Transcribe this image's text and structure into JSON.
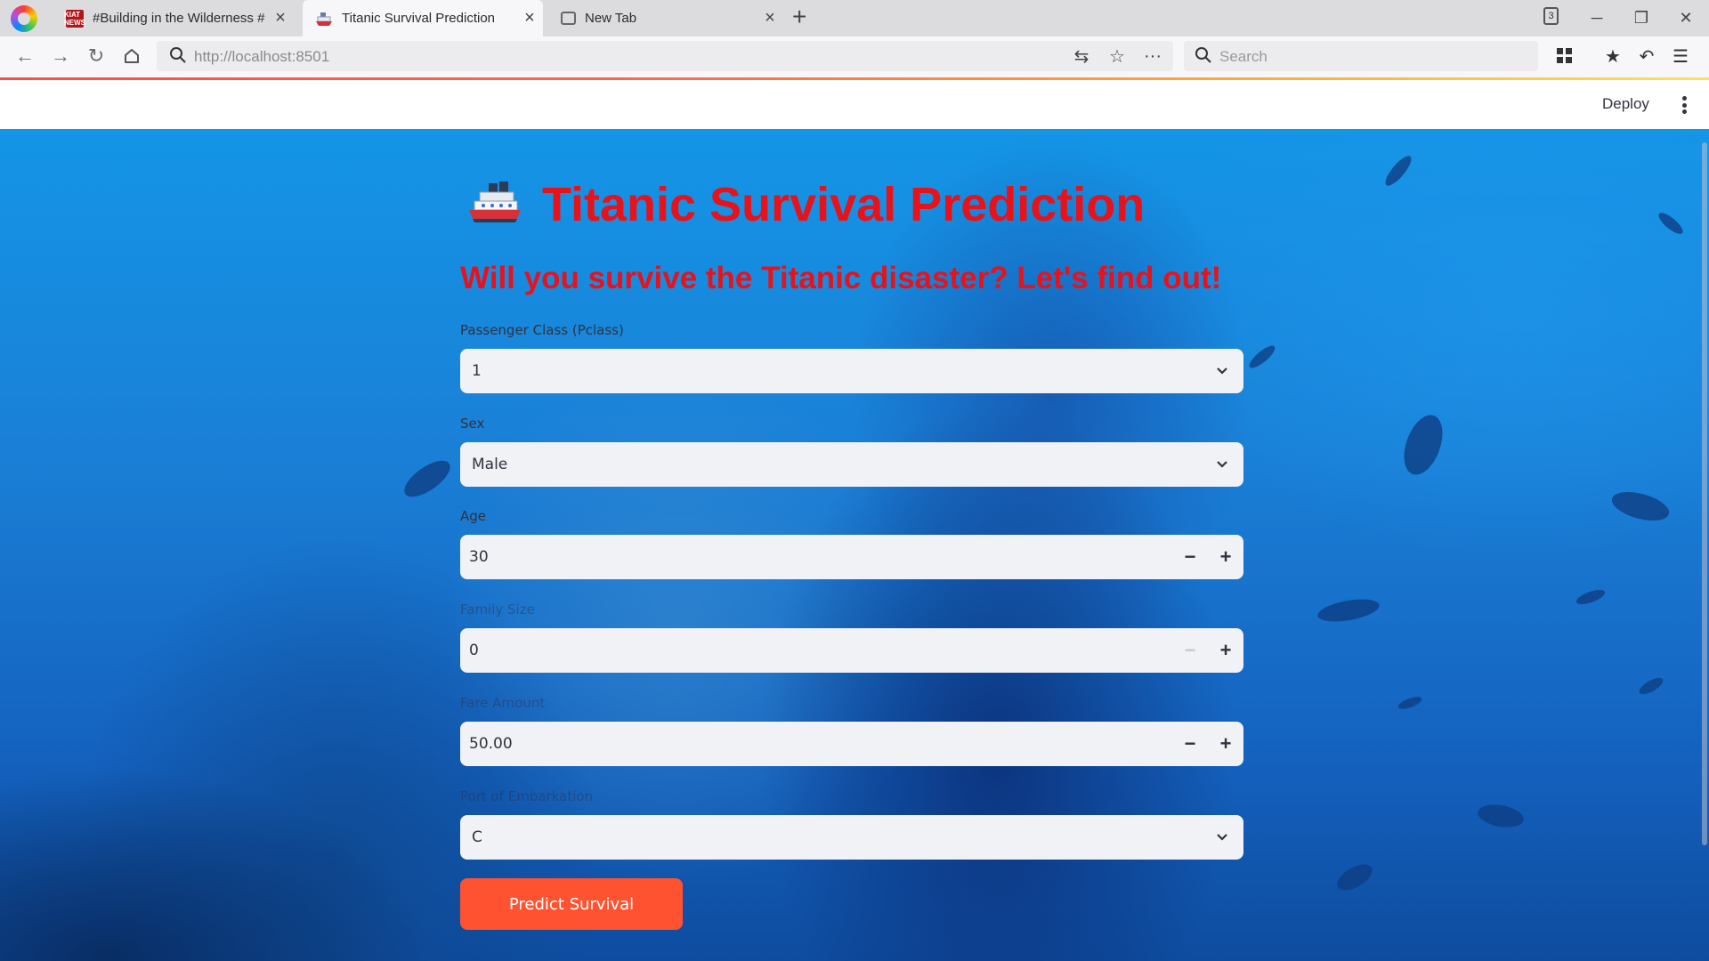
{
  "browser": {
    "tabs": [
      {
        "title": "#Building in the Wilderness #",
        "favicon": "news-favicon",
        "favicon_text": "KIAT NEWS"
      },
      {
        "title": "Titanic Survival Prediction",
        "favicon": "ship-favicon"
      },
      {
        "title": "New Tab",
        "favicon": "newtab-favicon"
      }
    ],
    "tab_count": "3",
    "url_host": "http://localhost",
    "url_port": ":8501",
    "search_placeholder": "Search"
  },
  "header": {
    "deploy_label": "Deploy"
  },
  "page": {
    "title": "Titanic Survival Prediction",
    "title_icon": "ship-icon",
    "subtitle": "Will you survive the Titanic disaster? Let's find out!"
  },
  "form": {
    "pclass": {
      "label": "Passenger Class (Pclass)",
      "value": "1"
    },
    "sex": {
      "label": "Sex",
      "value": "Male"
    },
    "age": {
      "label": "Age",
      "value": "30"
    },
    "family_size": {
      "label": "Family Size",
      "value": "0"
    },
    "fare": {
      "label": "Fare Amount",
      "value": "50.00"
    },
    "embarked": {
      "label": "Port of Embarkation",
      "value": "C"
    },
    "submit_label": "Predict Survival"
  },
  "colors": {
    "title": "#e8121b",
    "button": "#ff5230",
    "input_bg": "#f0f2f6"
  }
}
